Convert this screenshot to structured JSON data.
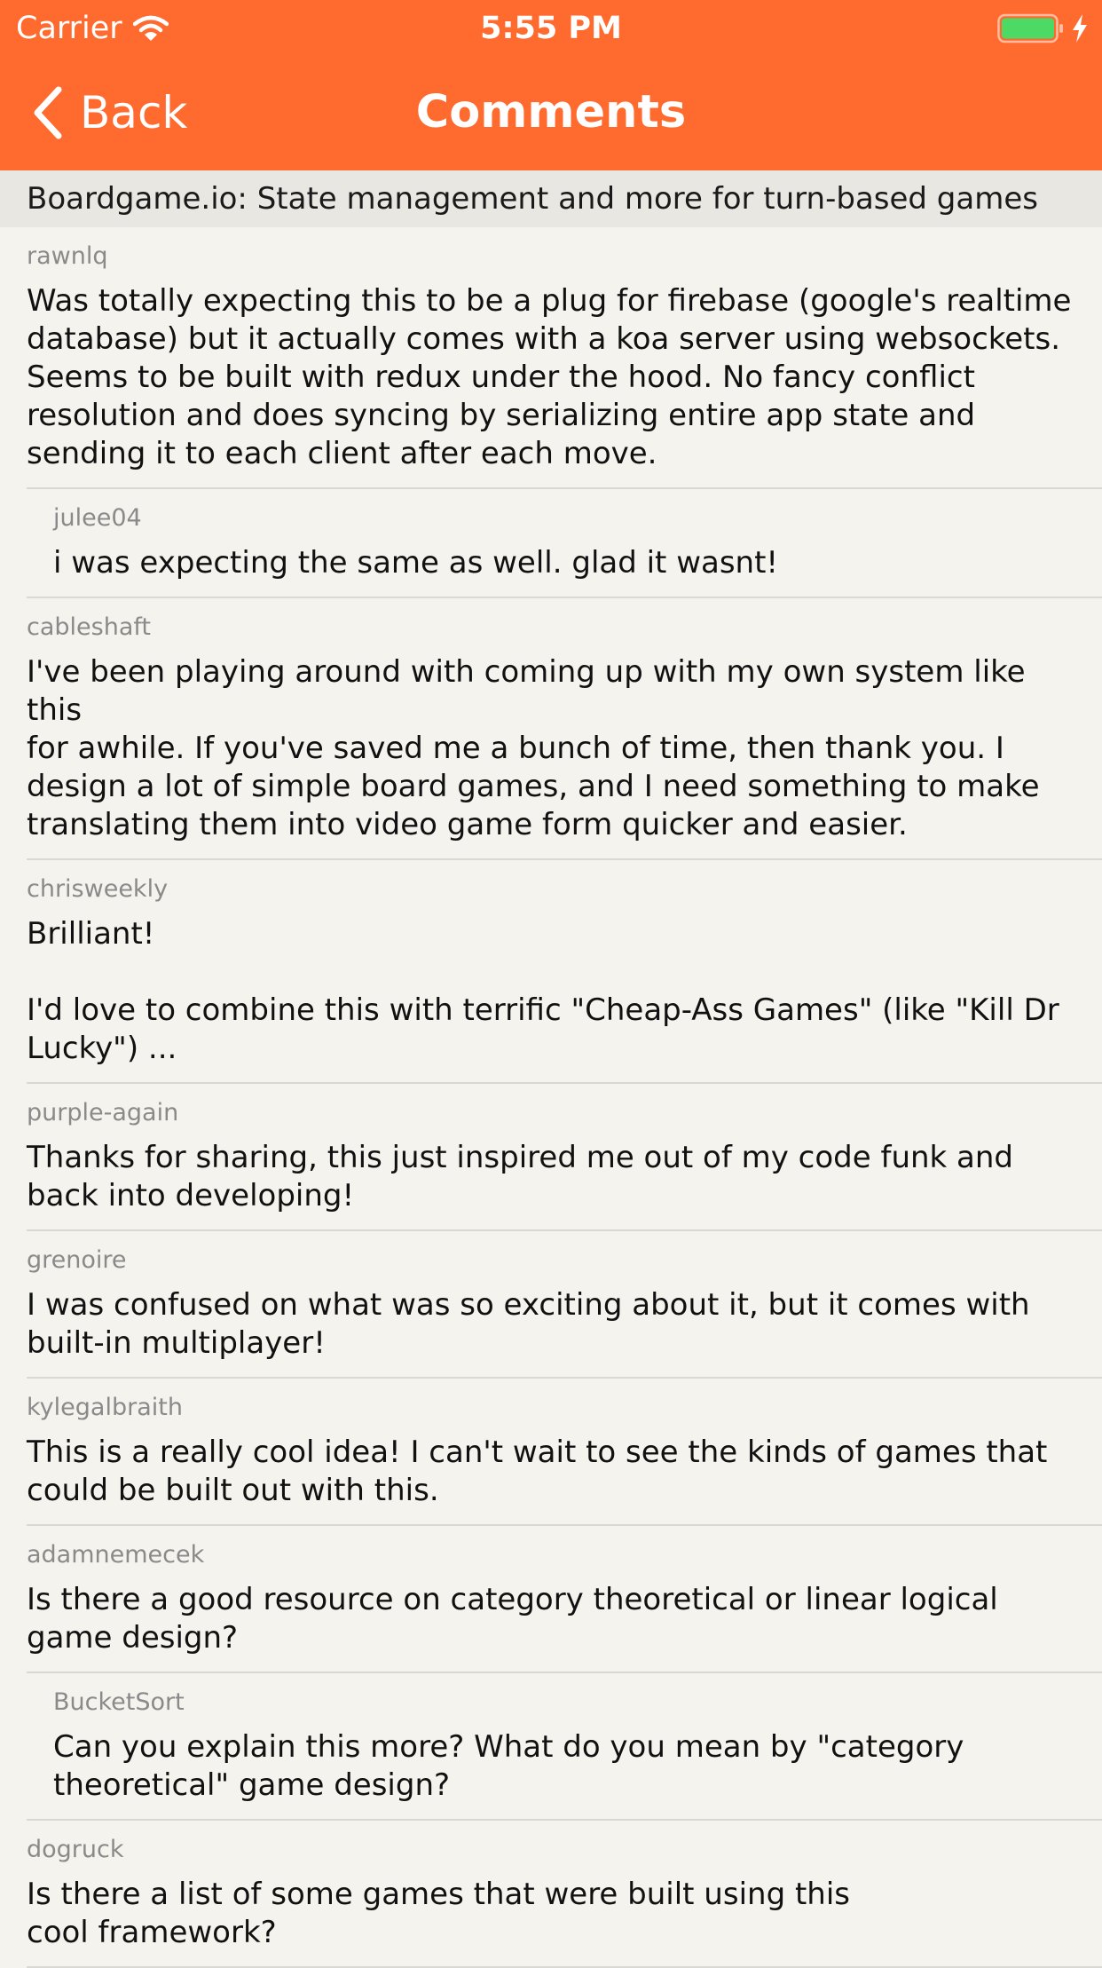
{
  "status_bar": {
    "carrier": "Carrier",
    "time": "5:55 PM",
    "battery_color": "#4cd964",
    "icons": [
      "wifi-icon",
      "battery-icon",
      "bolt-icon"
    ]
  },
  "nav": {
    "back_label": "Back",
    "title": "Comments",
    "bar_color": "#ff6a2e",
    "back_icon": "chevron-left-icon"
  },
  "story": {
    "title": "Boardgame.io: State management and more for turn-based games"
  },
  "comments": [
    {
      "author": "rawnlq",
      "indent": 0,
      "text": "Was totally expecting this to be a plug for firebase (google's realtime\ndatabase) but it actually comes with a koa server using websockets.\nSeems to be built with redux under the hood. No fancy conflict\nresolution and does syncing by serializing entire app state and\nsending it to each client after each move."
    },
    {
      "author": "julee04",
      "indent": 1,
      "text": "i was expecting the same as well. glad it wasnt!"
    },
    {
      "author": "cableshaft",
      "indent": 0,
      "text": "I've been playing around with coming up with my own system like this\nfor awhile. If you've saved me a bunch of time, then thank you. I\ndesign a lot of simple board games, and I need something to make\ntranslating them into video game form quicker and easier."
    },
    {
      "author": "chrisweekly",
      "indent": 0,
      "text": "Brilliant!\n\nI'd love to combine this with terrific \"Cheap-Ass Games\" (like \"Kill Dr\nLucky\") ..."
    },
    {
      "author": "purple-again",
      "indent": 0,
      "text": "Thanks for sharing, this just inspired me out of my code funk and\nback into developing!"
    },
    {
      "author": "grenoire",
      "indent": 0,
      "text": "I was confused on what was so exciting about it, but it comes with\nbuilt-in multiplayer!"
    },
    {
      "author": "kylegalbraith",
      "indent": 0,
      "text": "This is a really cool idea! I can't wait to see the kinds of games that\ncould be built out with this."
    },
    {
      "author": "adamnemecek",
      "indent": 0,
      "text": "Is there a good resource on category theoretical or linear logical\ngame design?"
    },
    {
      "author": "BucketSort",
      "indent": 1,
      "text": "Can you explain this more? What do you mean by \"category\ntheoretical\" game design?"
    },
    {
      "author": "dogruck",
      "indent": 0,
      "text": "Is there a list of some games that were built using this\ncool framework?"
    }
  ]
}
